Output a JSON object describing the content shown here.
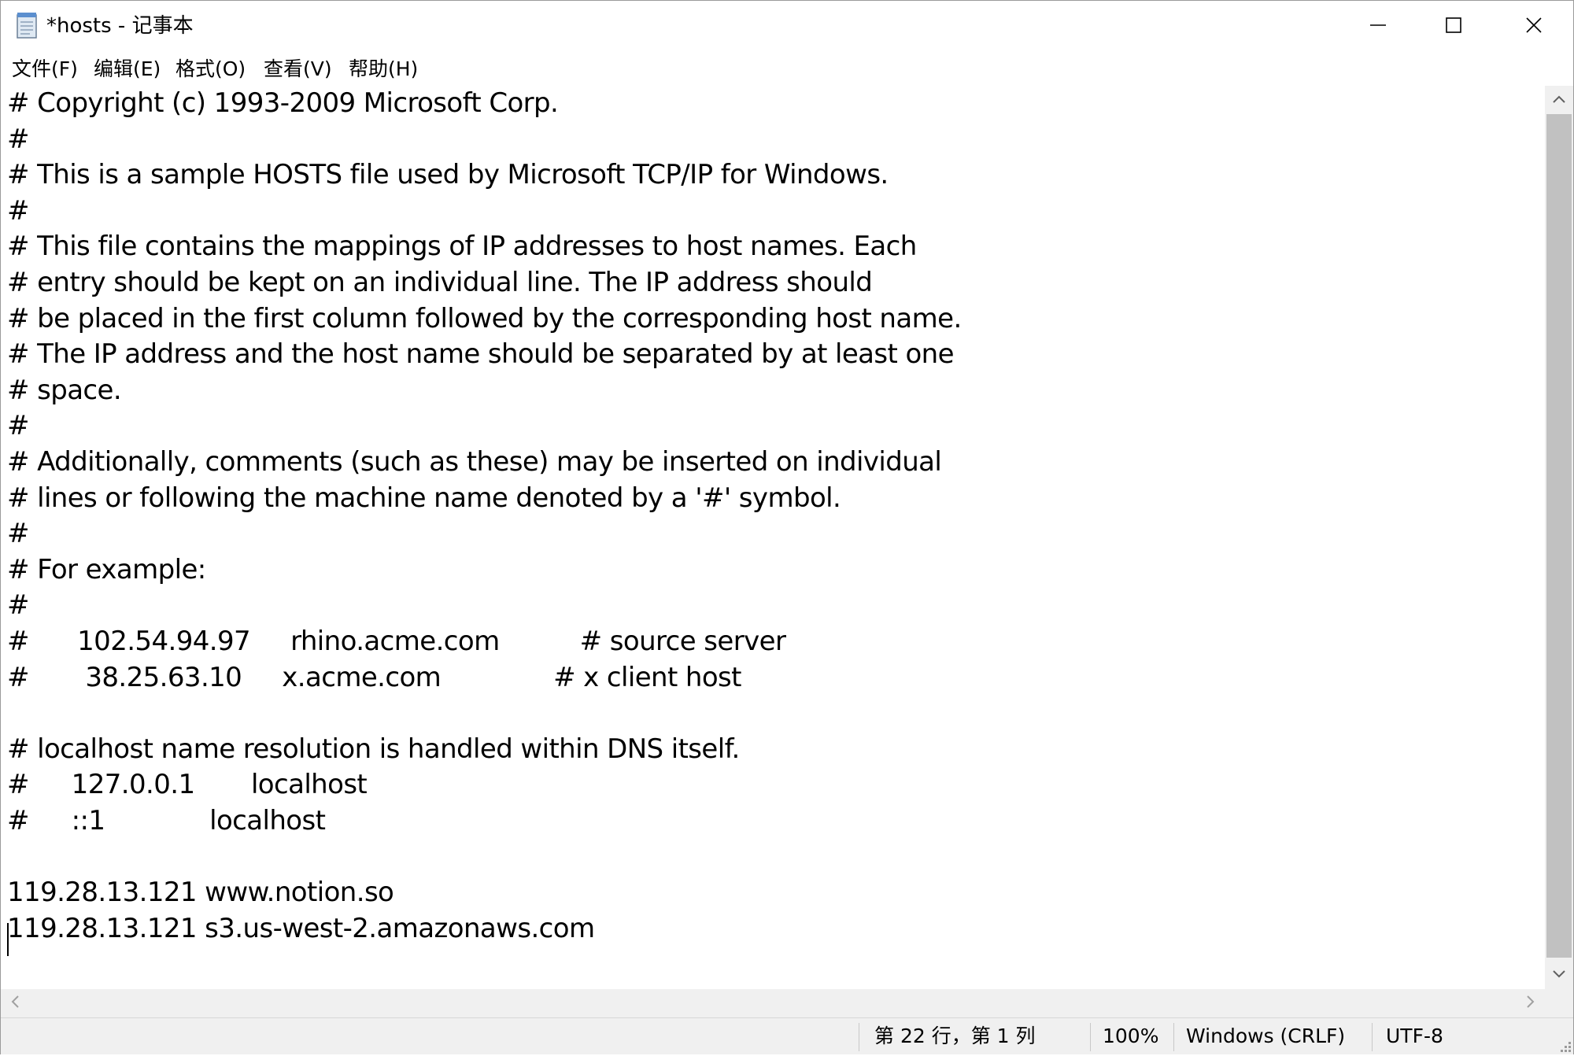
{
  "window": {
    "title": "*hosts - 记事本",
    "icon": "notepad-icon",
    "controls": [
      "minimize-icon",
      "maximize-icon",
      "close-icon"
    ]
  },
  "menu": {
    "items": [
      "文件(F)",
      "编辑(E)",
      "格式(O)",
      "查看(V)",
      "帮助(H)"
    ]
  },
  "editor": {
    "lines": [
      "# Copyright (c) 1993-2009 Microsoft Corp.",
      "#",
      "# This is a sample HOSTS file used by Microsoft TCP/IP for Windows.",
      "#",
      "# This file contains the mappings of IP addresses to host names. Each",
      "# entry should be kept on an individual line. The IP address should",
      "# be placed in the first column followed by the corresponding host name.",
      "# The IP address and the host name should be separated by at least one",
      "# space.",
      "#",
      "# Additionally, comments (such as these) may be inserted on individual",
      "# lines or following the machine name denoted by a '#' symbol.",
      "#",
      "# For example:",
      "#",
      "#      102.54.94.97     rhino.acme.com          # source server",
      "#       38.25.63.10     x.acme.com              # x client host",
      "",
      "# localhost name resolution is handled within DNS itself.",
      "#\t127.0.0.1       localhost",
      "#\t::1             localhost",
      "",
      "119.28.13.121 www.notion.so",
      "119.28.13.121 s3.us-west-2.amazonaws.com"
    ]
  },
  "status": {
    "position": "第 22 行，第 1 列",
    "zoom": "100%",
    "line_ending": "Windows (CRLF)",
    "encoding": "UTF-8"
  }
}
